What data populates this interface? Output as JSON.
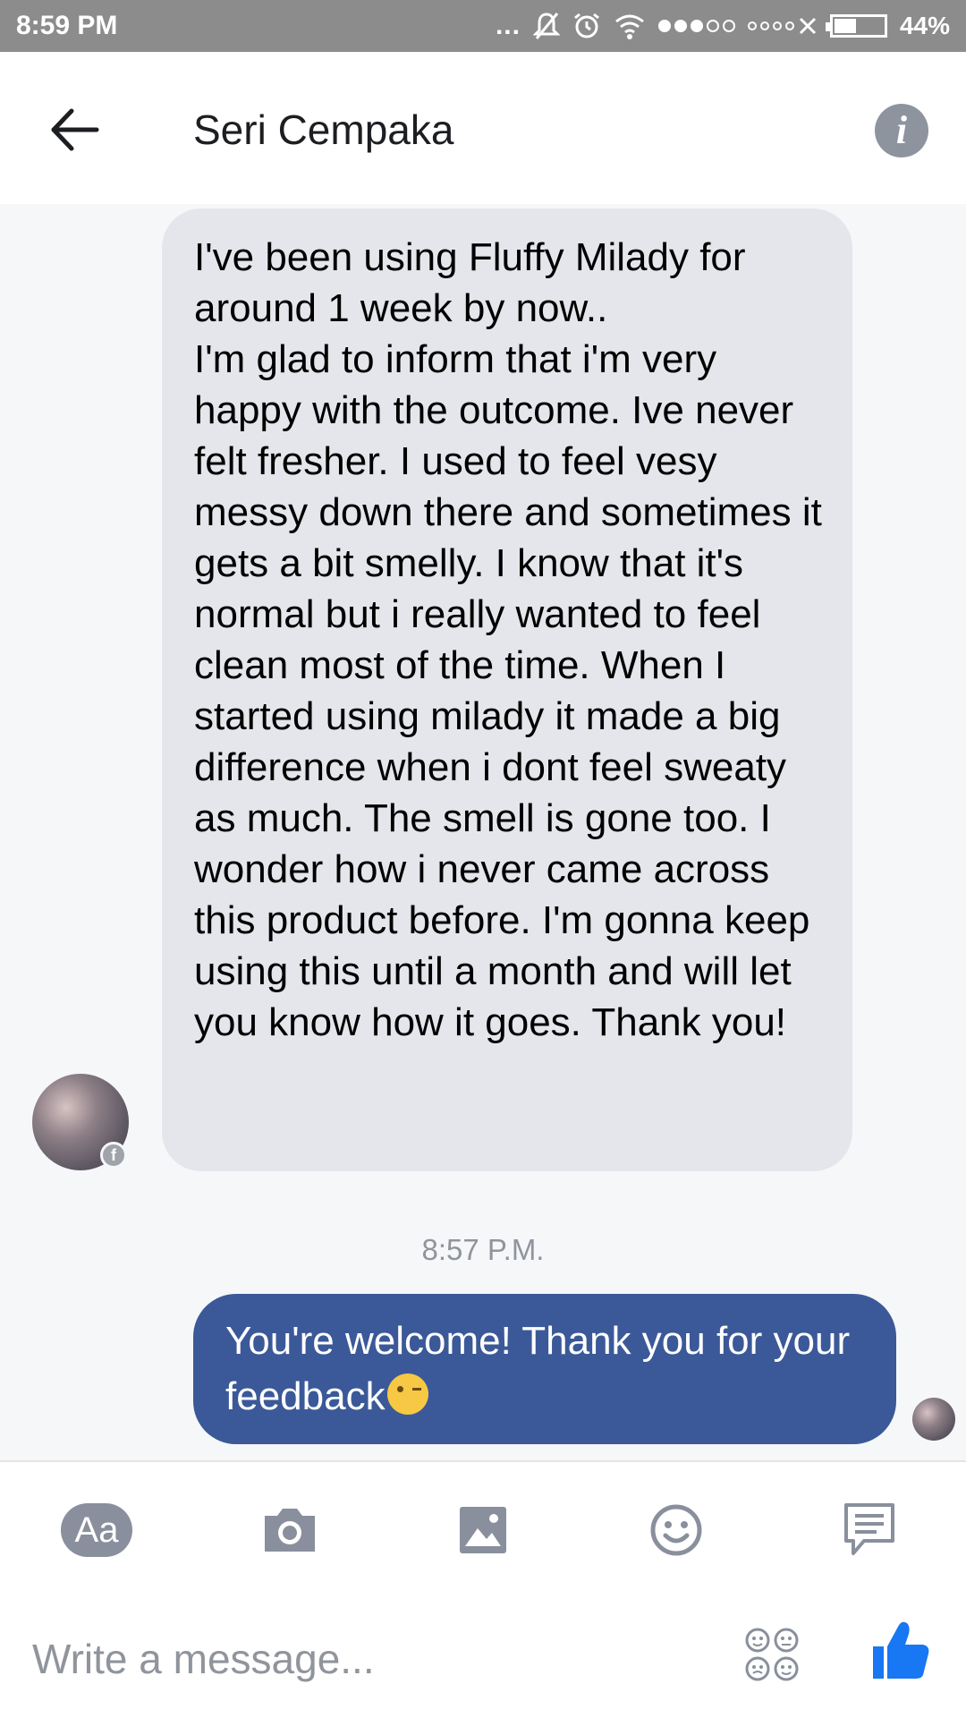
{
  "status_bar": {
    "time": "8:59 PM",
    "overflow": "...",
    "battery": "44%",
    "icons": [
      "muted-bell-icon",
      "alarm-icon",
      "wifi-icon",
      "signal-icon",
      "battery-icon"
    ]
  },
  "header": {
    "contact_name": "Seri Cempaka",
    "info_label": "i"
  },
  "conversation": {
    "incoming": {
      "text": "I've been using Fluffy Milady for around 1 week by now..\nI'm glad to inform that i'm very happy with the outcome. Ive never felt fresher. I used to feel vesy messy down there and sometimes it gets a bit smelly. I know that it's normal but i really wanted to feel clean most of the time. When I started using milady it made a big difference when i dont feel sweaty as much. The smell is gone too. I wonder how i never came across this product before. I'm gonna keep using this until a month and will let you know how it goes. Thank you!"
    },
    "timestamp": "8:57 P.M.",
    "outgoing": {
      "text": "You're welcome! Thank you for your feedback"
    }
  },
  "composer": {
    "aa_label": "Aa",
    "placeholder": "Write a message..."
  },
  "colors": {
    "outgoing_bubble": "#3b5998",
    "incoming_bubble": "#e4e6eb",
    "like_icon": "#1877f2",
    "status_bar": "#8c8c8c"
  }
}
